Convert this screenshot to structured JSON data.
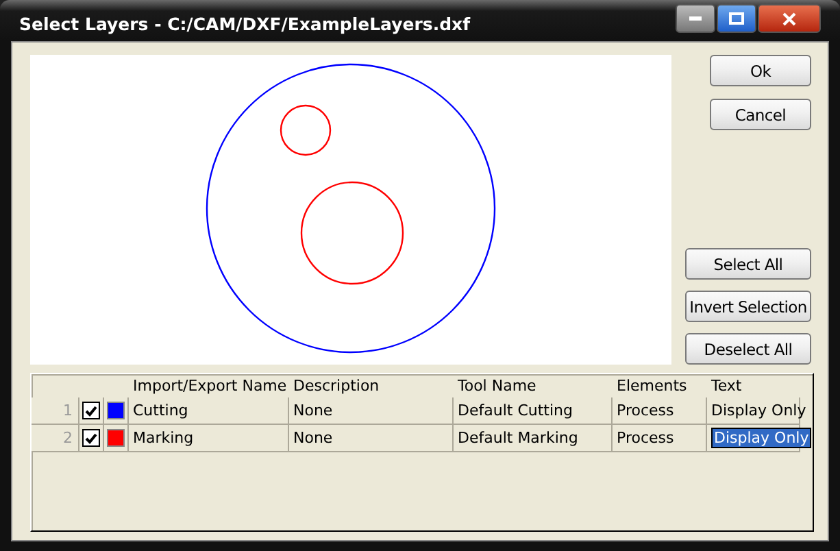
{
  "window": {
    "title": "Select Layers - C:/CAM/DXF/ExampleLayers.dxf"
  },
  "buttons_top": [
    "Ok",
    "Cancel"
  ],
  "buttons_selection": [
    "Select All",
    "Invert Selection",
    "Deselect All"
  ],
  "table": {
    "columns": [
      "Import/Export Name",
      "Description",
      "Tool Name",
      "Elements",
      "Text"
    ],
    "rows": [
      {
        "number": "1",
        "checked": true,
        "color": "#0000ff",
        "name": "Cutting",
        "description": "None",
        "tool": "Default Cutting",
        "elements": "Process",
        "text": "Display Only",
        "text_selected": false
      },
      {
        "number": "2",
        "checked": true,
        "color": "#ff0000",
        "name": "Marking",
        "description": "None",
        "tool": "Default Marking",
        "elements": "Process",
        "text": "Display Only",
        "text_selected": true
      }
    ]
  }
}
